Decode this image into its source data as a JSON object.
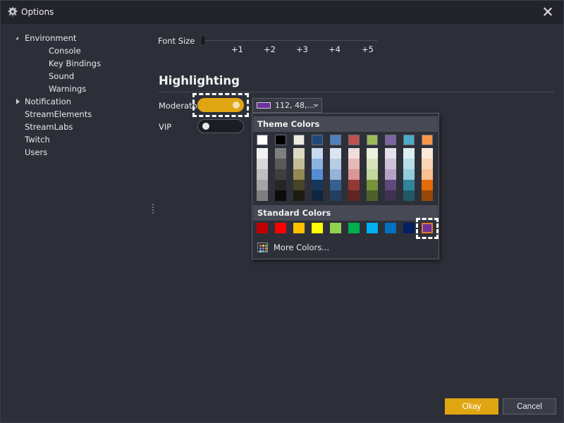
{
  "window": {
    "title": "Options",
    "close_icon": "close-icon",
    "app_icon": "app-logo-icon"
  },
  "tree": [
    {
      "label": "Environment",
      "depth": 0,
      "expander": "open"
    },
    {
      "label": "Console",
      "depth": 1,
      "expander": "none"
    },
    {
      "label": "Key Bindings",
      "depth": 1,
      "expander": "none"
    },
    {
      "label": "Sound",
      "depth": 1,
      "expander": "none"
    },
    {
      "label": "Warnings",
      "depth": 1,
      "expander": "none"
    },
    {
      "label": "Notification",
      "depth": 0,
      "expander": "closed"
    },
    {
      "label": "StreamElements",
      "depth": 0,
      "expander": "none"
    },
    {
      "label": "StreamLabs",
      "depth": 0,
      "expander": "none"
    },
    {
      "label": "Twitch",
      "depth": 0,
      "expander": "none"
    },
    {
      "label": "Users",
      "depth": 0,
      "expander": "none"
    }
  ],
  "font_size": {
    "label": "Font Size",
    "ticks": [
      "+1",
      "+2",
      "+3",
      "+4",
      "+5"
    ]
  },
  "highlighting": {
    "title": "Highlighting",
    "moderator": {
      "label": "Moderator",
      "enabled": true
    },
    "vip": {
      "label": "VIP",
      "enabled": false
    },
    "color_value_text": "112, 48,...",
    "selected_color": "#7030a0"
  },
  "color_popup": {
    "theme_header": "Theme Colors",
    "standard_header": "Standard Colors",
    "more_colors": "More Colors...",
    "theme_top": [
      "#ffffff",
      "#000000",
      "#eeece1",
      "#1f497d",
      "#4f81bd",
      "#c0504d",
      "#9bbb59",
      "#8064a2",
      "#4bacc6",
      "#f79646"
    ],
    "theme_shades": [
      [
        "#f2f2f2",
        "#d8d8d8",
        "#bfbfbf",
        "#a5a5a5",
        "#7f7f7f"
      ],
      [
        "#7f7f7f",
        "#595959",
        "#3f3f3f",
        "#262626",
        "#0c0c0c"
      ],
      [
        "#ddd9c3",
        "#c4bd97",
        "#938953",
        "#494429",
        "#1d1b10"
      ],
      [
        "#c6d9f0",
        "#8db3e2",
        "#548dd4",
        "#17365d",
        "#0f243e"
      ],
      [
        "#dbe5f1",
        "#b8cce4",
        "#95b3d7",
        "#366092",
        "#244061"
      ],
      [
        "#f2dcdb",
        "#e5b9b7",
        "#d99694",
        "#953734",
        "#632423"
      ],
      [
        "#ebf1dd",
        "#d7e3bc",
        "#c3d69b",
        "#76923c",
        "#4f6128"
      ],
      [
        "#e5e0ec",
        "#ccc1d9",
        "#b2a2c7",
        "#5f497a",
        "#3f3151"
      ],
      [
        "#dbeef3",
        "#b7dde8",
        "#92cddc",
        "#31859b",
        "#205867"
      ],
      [
        "#fdeada",
        "#fbd5b5",
        "#fac08f",
        "#e36c09",
        "#974806"
      ]
    ],
    "standard": [
      "#c00000",
      "#ff0000",
      "#ffc000",
      "#ffff00",
      "#92d050",
      "#00b050",
      "#00b0f0",
      "#0070c0",
      "#002060",
      "#7030a0"
    ],
    "selected_standard_index": 9
  },
  "buttons": {
    "ok": "Okay",
    "cancel": "Cancel"
  },
  "colors": {
    "accent": "#e0a611",
    "background": "#2d2f38",
    "titlebar": "#23242b"
  }
}
